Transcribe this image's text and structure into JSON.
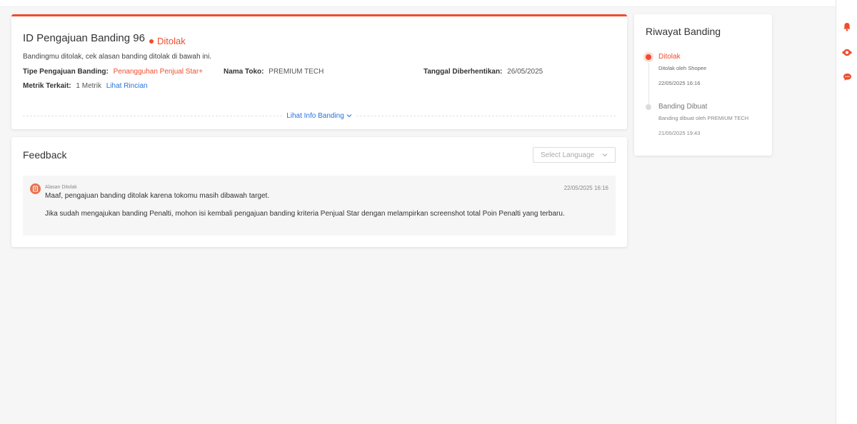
{
  "appeal": {
    "title": "ID Pengajuan Banding 96",
    "status": "Ditolak",
    "description": "Bandingmu ditolak, cek alasan banding ditolak di bawah ini.",
    "fields": {
      "type_label": "Tipe Pengajuan Banding:",
      "type_value": "Penangguhan Penjual Star+",
      "shop_label": "Nama Toko:",
      "shop_value": "PREMIUM TECH",
      "stopped_label": "Tanggal Diberhentikan:",
      "stopped_value": "26/05/2025",
      "metric_label": "Metrik Terkait:",
      "metric_value": "1 Metrik",
      "metric_link": "Lihat Rincian"
    },
    "info_link": "Lihat Info Banding"
  },
  "feedback": {
    "title": "Feedback",
    "language_placeholder": "Select Language",
    "entry": {
      "label": "Alasan Ditolak",
      "date": "22/05/2025 16:16",
      "line1": "Maaf, pengajuan banding ditolak karena tokomu masih dibawah target.",
      "line2": "Jika sudah mengajukan banding Penalti, mohon isi kembali pengajuan banding kriteria Penjual Star dengan melampirkan screenshot total Poin Penalti yang terbaru."
    }
  },
  "history": {
    "title": "Riwayat Banding",
    "items": [
      {
        "status": "Ditolak",
        "by": "Ditolak oleh Shopee",
        "time": "22/05/2025 16:16"
      },
      {
        "status": "Banding Dibuat",
        "by": "Banding dibuat oleh PREMIUM TECH",
        "time": "21/05/2025 19:43"
      }
    ]
  },
  "colors": {
    "accent": "#ee4d2d",
    "link": "#2673dd"
  },
  "icons": {
    "rail": [
      "notification-bell-icon",
      "customer-service-icon",
      "chat-icon"
    ]
  }
}
